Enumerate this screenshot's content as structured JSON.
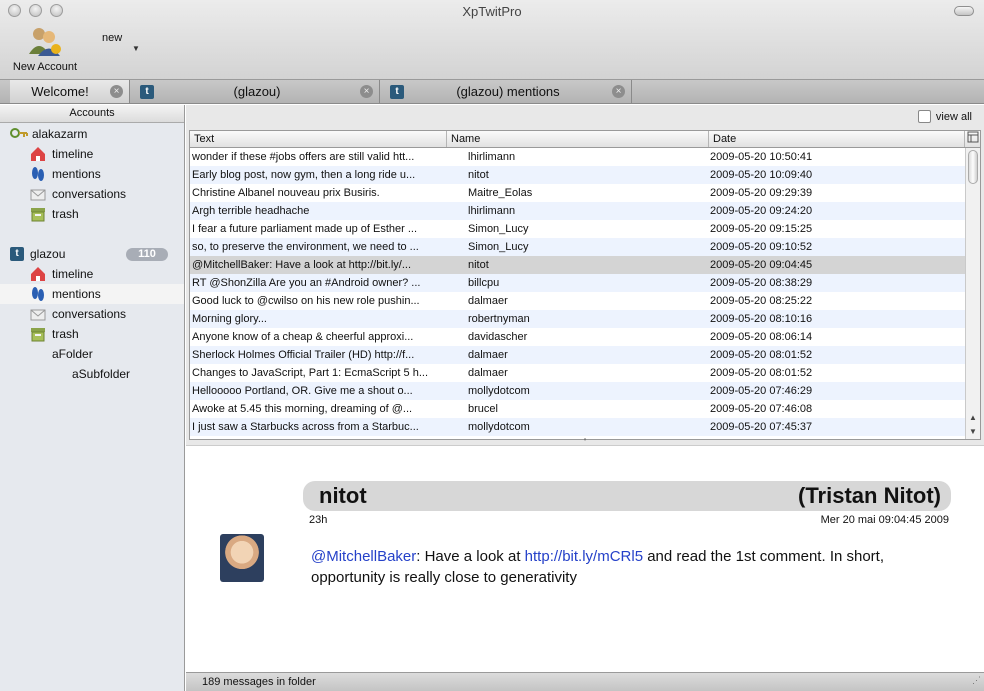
{
  "window": {
    "title": "XpTwitPro"
  },
  "toolbar": {
    "new_account_label": "New Account",
    "new_menu_label": "new"
  },
  "tabs": [
    {
      "label": "Welcome!"
    },
    {
      "label": "(glazou)"
    },
    {
      "label": "(glazou) mentions"
    }
  ],
  "sidebar": {
    "header": "Accounts",
    "accounts": [
      {
        "name": "alakazarm",
        "badge": "",
        "items": [
          {
            "label": "timeline"
          },
          {
            "label": "mentions"
          },
          {
            "label": "conversations"
          },
          {
            "label": "trash"
          }
        ]
      },
      {
        "name": "glazou",
        "badge": "110",
        "items": [
          {
            "label": "timeline"
          },
          {
            "label": "mentions"
          },
          {
            "label": "conversations"
          },
          {
            "label": "trash"
          }
        ],
        "folders": [
          {
            "label": "aFolder"
          },
          {
            "label": "aSubfolder"
          }
        ]
      }
    ]
  },
  "list": {
    "view_all_label": "view all",
    "columns": {
      "text": "Text",
      "name": "Name",
      "date": "Date"
    },
    "rows": [
      {
        "text": "wonder if these #jobs offers are still valid htt...",
        "name": "lhirlimann",
        "date": "2009-05-20 10:50:41"
      },
      {
        "text": "Early blog post, now gym, then a long ride u...",
        "name": "nitot",
        "date": "2009-05-20 10:09:40"
      },
      {
        "text": "Christine Albanel nouveau prix Busiris.",
        "name": "Maitre_Eolas",
        "date": "2009-05-20 09:29:39"
      },
      {
        "text": "Argh terrible headhache",
        "name": "lhirlimann",
        "date": "2009-05-20 09:24:20"
      },
      {
        "text": "I fear a future parliament made up of Esther ...",
        "name": "Simon_Lucy",
        "date": "2009-05-20 09:15:25"
      },
      {
        "text": "so, to preserve the environment, we need to ...",
        "name": "Simon_Lucy",
        "date": "2009-05-20 09:10:52"
      },
      {
        "text": "@MitchellBaker: Have a look at http://bit.ly/...",
        "name": "nitot",
        "date": "2009-05-20 09:04:45"
      },
      {
        "text": "RT @ShonZilla Are you an #Android owner? ...",
        "name": "billcpu",
        "date": "2009-05-20 08:38:29"
      },
      {
        "text": "Good luck to @cwilso on his new role pushin...",
        "name": "dalmaer",
        "date": "2009-05-20 08:25:22"
      },
      {
        "text": "Morning glory...",
        "name": "robertnyman",
        "date": "2009-05-20 08:10:16"
      },
      {
        "text": "Anyone know of a cheap & cheerful approxi...",
        "name": "davidascher",
        "date": "2009-05-20 08:06:14"
      },
      {
        "text": "Sherlock Holmes Official Trailer (HD) http://f...",
        "name": "dalmaer",
        "date": "2009-05-20 08:01:52"
      },
      {
        "text": "Changes to JavaScript, Part 1: EcmaScript 5 h...",
        "name": "dalmaer",
        "date": "2009-05-20 08:01:52"
      },
      {
        "text": "Hellooooo Portland, OR. Give me a shout o...",
        "name": "mollydotcom",
        "date": "2009-05-20 07:46:29"
      },
      {
        "text": "Awoke at 5.45 this morning, dreaming of @...",
        "name": "brucel",
        "date": "2009-05-20 07:46:08"
      },
      {
        "text": "I just saw a Starbucks across from a Starbuc...",
        "name": "mollydotcom",
        "date": "2009-05-20 07:45:37"
      }
    ],
    "selected_index": 6
  },
  "detail": {
    "screen_name": "nitot",
    "full_name": "(Tristan Nitot)",
    "age": "23h",
    "full_date": "Mer 20 mai 09:04:45 2009",
    "message_mention": "@MitchellBaker",
    "message_part1": ": Have a look at ",
    "message_link": "http://bit.ly/mCRl5",
    "message_part2": " and read the 1st comment. In short, opportunity is really close to generativity"
  },
  "status": {
    "text": "189 messages in folder"
  },
  "colors": {
    "link": "#2541c9",
    "selection_row": "#d4d4d4",
    "alt_row": "#edf3fe",
    "sidebar_bg": "#e6e9ee"
  }
}
